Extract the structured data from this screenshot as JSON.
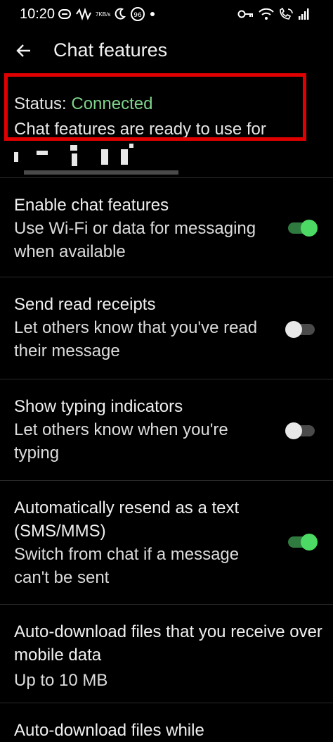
{
  "status_bar": {
    "time": "10:20",
    "speed_value": "7",
    "speed_unit": "KB/s",
    "battery": "96",
    "icons": [
      "message-icon",
      "pulse-icon",
      "speed-indicator",
      "moon-icon",
      "battery-badge-icon",
      "dot-icon",
      "key-icon",
      "wifi-icon",
      "wifi-calling-icon",
      "signal-icon"
    ]
  },
  "header": {
    "title": "Chat features",
    "back_icon": "arrow-left-icon"
  },
  "status": {
    "label": "Status: ",
    "value": "Connected",
    "description": "Chat features are ready to use for",
    "value_color": "#7fd38a",
    "highlight_color": "#e00000"
  },
  "settings": [
    {
      "title": "Enable chat features",
      "subtitle": "Use Wi-Fi or data for messaging when available",
      "toggle": true
    },
    {
      "title": "Send read receipts",
      "subtitle": "Let others know that you've read their message",
      "toggle": false
    },
    {
      "title": "Show typing indicators",
      "subtitle": "Let others know when you're typing",
      "toggle": false
    },
    {
      "title": "Automatically resend as a text (SMS/MMS)",
      "subtitle": "Switch from chat if a message can't be sent",
      "toggle": true
    },
    {
      "title": "Auto-download files that you receive over mobile data",
      "subtitle": "Up to 10 MB"
    },
    {
      "title": "Auto-download files while"
    }
  ],
  "colors": {
    "background": "#000000",
    "toggle_on": "#4cd964",
    "toggle_off_thumb": "#e8e8e8"
  }
}
